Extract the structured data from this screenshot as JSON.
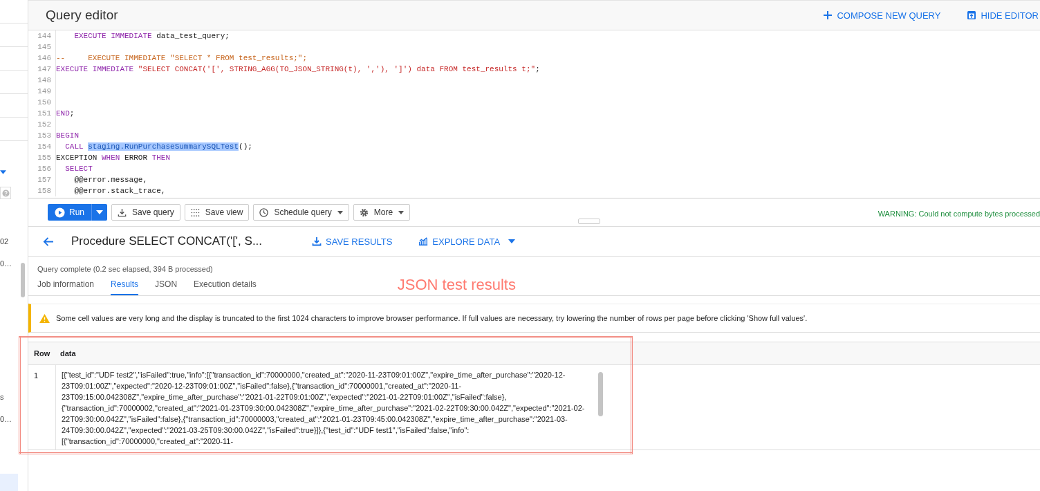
{
  "sidebar": {
    "items": [
      {
        "text": "02",
        "selected": false
      },
      {
        "text": "0…",
        "selected": false
      },
      {
        "text": "s",
        "selected": false
      },
      {
        "text": "0…",
        "selected": false
      },
      {
        "selected": true
      }
    ]
  },
  "header": {
    "title": "Query editor",
    "actions": [
      "COMPOSE NEW QUERY",
      "HIDE EDITOR"
    ]
  },
  "editor": {
    "lines": [
      {
        "number": "144",
        "tokens": [
          {
            "kind": "keyword",
            "text": "    EXECUTE IMMEDIATE"
          },
          {
            "kind": "plain",
            "text": " data_test_query;"
          }
        ]
      },
      {
        "number": "145"
      },
      {
        "number": "146",
        "tokens": [
          {
            "kind": "comment",
            "text": "--     EXECUTE IMMEDIATE \"SELECT * FROM test_results;\";"
          }
        ]
      },
      {
        "number": "147",
        "tokens": [
          {
            "kind": "keyword",
            "text": "EXECUTE IMMEDIATE"
          },
          {
            "kind": "string",
            "text": " \"SELECT CONCAT('[', STRING_AGG(TO_JSON_STRING(t), ','), ']') data FROM test_results t;\""
          },
          {
            "kind": "plain",
            "text": ";"
          }
        ]
      },
      {
        "number": "148"
      },
      {
        "number": "149"
      },
      {
        "number": "150"
      },
      {
        "number": "151",
        "tokens": [
          {
            "kind": "keyword",
            "text": "END"
          },
          {
            "kind": "plain",
            "text": ";"
          }
        ]
      },
      {
        "number": "152"
      },
      {
        "number": "153",
        "tokens": [
          {
            "kind": "keyword",
            "text": "BEGIN"
          }
        ]
      },
      {
        "number": "154",
        "tokens": [
          {
            "kind": "keyword",
            "text": "  CALL "
          },
          {
            "kind": "highlight",
            "text": "staging.RunPurchaseSummarySQLTest"
          },
          {
            "kind": "plain",
            "text": "();"
          }
        ]
      },
      {
        "number": "155",
        "tokens": [
          {
            "kind": "plain",
            "text": "EXCEPTION"
          },
          {
            "kind": "keyword",
            "text": " WHEN "
          },
          {
            "kind": "plain",
            "text": "ERROR"
          },
          {
            "kind": "keyword",
            "text": " THEN"
          }
        ]
      },
      {
        "number": "156",
        "tokens": [
          {
            "kind": "keyword",
            "text": "  SELECT"
          }
        ]
      },
      {
        "number": "157",
        "tokens": [
          {
            "kind": "plain",
            "text": "    @@error.message,"
          }
        ]
      },
      {
        "number": "158",
        "tokens": [
          {
            "kind": "plain",
            "text": "    @@error.stack_trace,"
          }
        ]
      }
    ]
  },
  "toolbar": {
    "run": "Run",
    "buttons": [
      {
        "kind": "save",
        "label": "Save query",
        "dropdown": false
      },
      {
        "kind": "view",
        "label": "Save view",
        "dropdown": false
      },
      {
        "kind": "schedule",
        "label": "Schedule query",
        "dropdown": true
      },
      {
        "kind": "more",
        "label": "More",
        "dropdown": true
      }
    ],
    "warning": "WARNING: Could not compute bytes processed"
  },
  "results": {
    "title": "Procedure SELECT CONCAT('[', S...",
    "actions": [
      "SAVE RESULTS",
      "EXPLORE DATA"
    ],
    "status": "Query complete (0.2 sec elapsed, 394 B processed)",
    "tabs": [
      {
        "label": "Job information",
        "selected": false
      },
      {
        "label": "Results",
        "selected": true
      },
      {
        "label": "JSON",
        "selected": false
      },
      {
        "label": "Execution details",
        "selected": false
      }
    ],
    "annotation": "JSON test results",
    "notice": "Some cell values are very long and the display is truncated to the first 1024 characters to improve browser performance. If full values are necessary, try lowering the number of rows per page before clicking 'Show full values'.",
    "table": {
      "columns": [
        "Row",
        "data"
      ],
      "rows": [
        {
          "row": "1",
          "data": "[{\"test_id\":\"UDF test2\",\"isFailed\":true,\"info\":[{\"transaction_id\":70000000,\"created_at\":\"2020-11-23T09:01:00Z\",\"expire_time_after_purchase\":\"2020-12-23T09:01:00Z\",\"expected\":\"2020-12-23T09:01:00Z\",\"isFailed\":false},{\"transaction_id\":70000001,\"created_at\":\"2020-11-23T09:15:00.042308Z\",\"expire_time_after_purchase\":\"2021-01-22T09:01:00Z\",\"expected\":\"2021-01-22T09:01:00Z\",\"isFailed\":false},{\"transaction_id\":70000002,\"created_at\":\"2021-01-23T09:30:00.042308Z\",\"expire_time_after_purchase\":\"2021-02-22T09:30:00.042Z\",\"expected\":\"2021-02-22T09:30:00.042Z\",\"isFailed\":false},{\"transaction_id\":70000003,\"created_at\":\"2021-01-23T09:45:00.042308Z\",\"expire_time_after_purchase\":\"2021-03-24T09:30:00.042Z\",\"expected\":\"2021-03-25T09:30:00.042Z\",\"isFailed\":true}]},{\"test_id\":\"UDF test1\",\"isFailed\":false,\"info\":[{\"transaction_id\":70000000,\"created_at\":\"2020-11-"
        }
      ]
    }
  }
}
